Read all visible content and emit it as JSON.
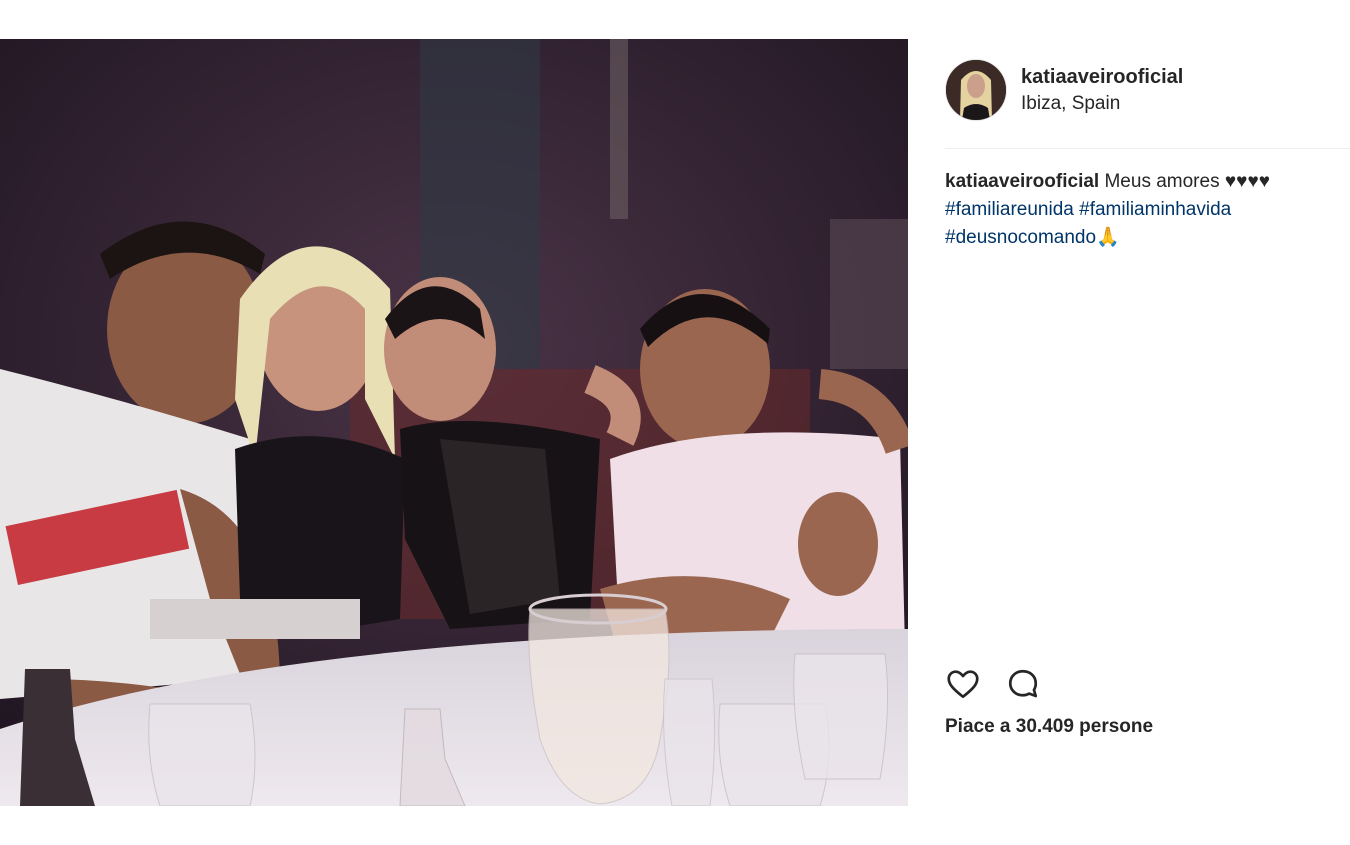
{
  "post": {
    "username": "katiaaveirooficial",
    "location": "Ibiza, Spain",
    "caption": {
      "username": "katiaaveirooficial",
      "text": "Meus amores",
      "hearts": "♥♥♥♥",
      "hashtags": [
        "#familiareunida",
        "#familiaminhavida",
        "#deusnocomando"
      ],
      "trailing_emoji": "🙏"
    },
    "likes": {
      "label": "Piace a 30.409 persone"
    }
  },
  "icons": {
    "like": "heart-icon",
    "comment": "comment-icon"
  },
  "colors": {
    "text": "#262626",
    "hashtag": "#003569",
    "divider": "#efefef"
  }
}
